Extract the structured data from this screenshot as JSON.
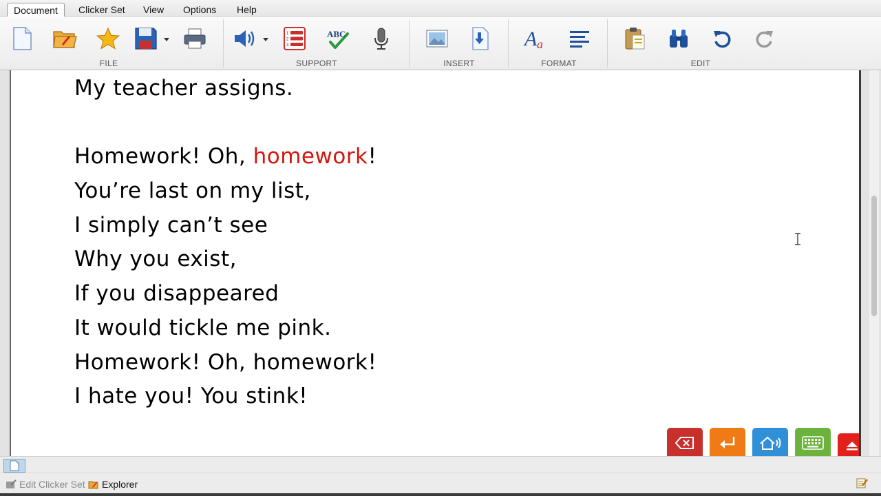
{
  "menu": {
    "items": [
      "Document",
      "Clicker Set",
      "View",
      "Options",
      "Help"
    ],
    "active_index": 0
  },
  "ribbon": {
    "groups": {
      "file": "FILE",
      "support": "SUPPORT",
      "insert": "INSERT",
      "format": "FORMAT",
      "edit": "EDIT"
    },
    "spellcheck_icon_text": "ABC"
  },
  "document": {
    "lines": [
      "My teacher assigns.",
      "",
      "Homework! Oh, ",
      "You’re last on my list,",
      "I simply can’t see",
      "Why you exist,",
      "If you disappeared",
      "It would tickle me pink.",
      "Homework! Oh, homework!",
      "I hate you! You stink!"
    ],
    "highlighted_word": "homework",
    "highlight_suffix": "!",
    "highlight_color": "#d4160e"
  },
  "clicker_buttons": [
    {
      "name": "delete",
      "color": "#c8302c"
    },
    {
      "name": "enter",
      "color": "#f07a14"
    },
    {
      "name": "speak-home",
      "color": "#2f8fd8"
    },
    {
      "name": "keyboard",
      "color": "#6cb33e"
    },
    {
      "name": "collapse",
      "color": "#e3201b"
    }
  ],
  "bottom": {
    "edit_clicker_set": "Edit Clicker Set",
    "explorer": "Explorer"
  }
}
